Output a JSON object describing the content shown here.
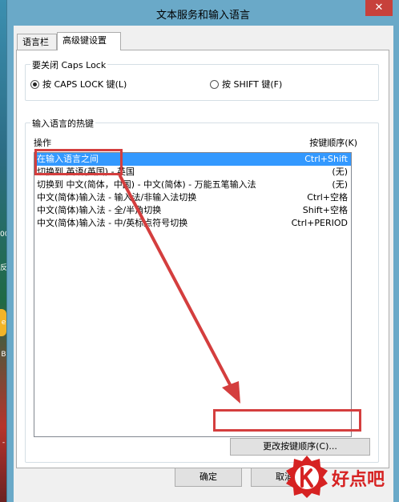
{
  "window": {
    "title": "文本服务和输入语言",
    "close_glyph": "✕"
  },
  "desktop": {
    "side_labels": [
      "00",
      "反",
      "e",
      "B",
      "-"
    ]
  },
  "tabs": [
    {
      "label": "语言栏",
      "active": false
    },
    {
      "label": "高级键设置",
      "active": true
    }
  ],
  "caps_lock": {
    "group_title": "要关闭 Caps Lock",
    "options": [
      {
        "label": "按 CAPS LOCK 键(L)",
        "checked": true
      },
      {
        "label": "按 SHIFT 键(F)",
        "checked": false
      }
    ]
  },
  "hotkeys": {
    "group_title": "输入语言的热键",
    "col_action": "操作",
    "col_sequence": "按键顺序(K)",
    "rows": [
      {
        "action": "在输入语言之间",
        "keys": "Ctrl+Shift",
        "selected": true
      },
      {
        "action": "切换到 英语(英国) - 英国",
        "keys": "(无)",
        "selected": false
      },
      {
        "action": "切换到 中文(简体，中国) - 中文(简体) - 万能五笔输入法",
        "keys": "(无)",
        "selected": false
      },
      {
        "action": "中文(简体)输入法 - 输入法/非输入法切换",
        "keys": "Ctrl+空格",
        "selected": false
      },
      {
        "action": "中文(简体)输入法 - 全/半角切换",
        "keys": "Shift+空格",
        "selected": false
      },
      {
        "action": "中文(简体)输入法 - 中/英标点符号切换",
        "keys": "Ctrl+PERIOD",
        "selected": false
      }
    ],
    "change_button": "更改按键顺序(C)..."
  },
  "footer": {
    "ok": "确定",
    "cancel": "取消"
  },
  "watermark": {
    "text": "好点吧"
  },
  "colors": {
    "annotation": "#d43e3e",
    "selection": "#3399ff"
  }
}
